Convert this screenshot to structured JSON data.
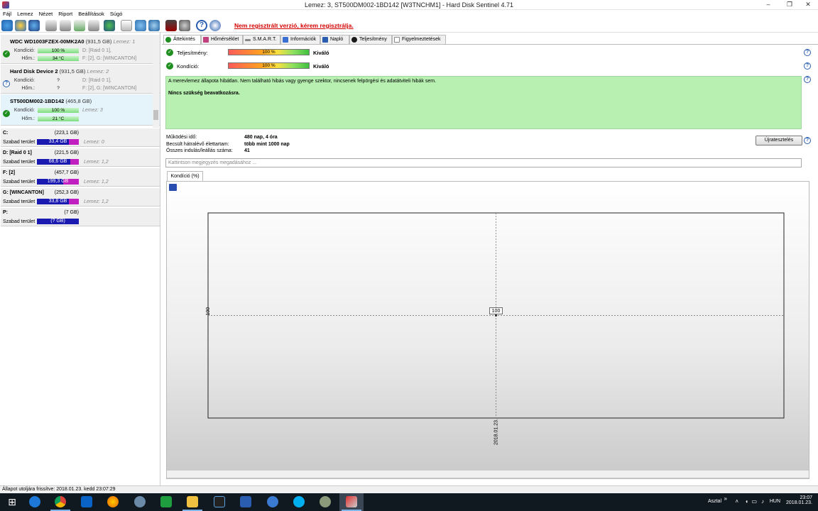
{
  "window": {
    "title": "Lemez: 3, ST500DM002-1BD142 [W3TNCHM1]  -  Hard Disk Sentinel 4.71",
    "minimize": "–",
    "maximize": "❐",
    "close": "✕"
  },
  "menu": [
    "Fájl",
    "Lemez",
    "Nézet",
    "Riport",
    "Beállítások",
    "Súgó"
  ],
  "toolbar": {
    "registration_warning": "Nem regisztrált verzió, kérem regisztrálja."
  },
  "disks": [
    {
      "name": "WDC WD1003FZEX-00MK2A0",
      "size": "(931,5 GB)",
      "disk_num": "Lemez: 1",
      "status": "ok",
      "health_label": "Kondíció:",
      "health": "100 %",
      "health_fraction": 1.0,
      "temp_label": "Hőm.:",
      "temp": "34 °C",
      "temp_bar": true,
      "part1": "D: [Raid 0 1],",
      "part2": "F: [2], G: [WINCANTON]"
    },
    {
      "name": "Hard Disk Device 2",
      "size": "(931,5 GB)",
      "disk_num": "Lemez: 2",
      "status": "unknown",
      "health_label": "Kondíció:",
      "health": "?",
      "temp_label": "Hőm.:",
      "temp": "?",
      "temp_bar": false,
      "part1": "D: [Raid 0 1],",
      "part2": "F: [2], G: [WINCANTON]"
    },
    {
      "name": "ST500DM002-1BD142",
      "size": "(465,8 GB)",
      "disk_num": "Lemez: 3",
      "status": "ok",
      "health_label": "Kondíció:",
      "health": "100 %",
      "health_fraction": 1.0,
      "temp_label": "Hőm.:",
      "temp": "21 °C",
      "temp_bar": true,
      "part1": "",
      "part2": ""
    }
  ],
  "volumes": [
    {
      "name": "C:",
      "size": "(223,1 GB)",
      "free_label": "Szabad terület",
      "free": "33,4 GB",
      "disk": "Lemez: 0"
    },
    {
      "name": "D: [Raid 0 1]",
      "size": "(221,5 GB)",
      "free_label": "Szabad terület",
      "free": "68,6 GB",
      "disk": "Lemez: 1,2"
    },
    {
      "name": "F: [2]",
      "size": "(457,7 GB)",
      "free_label": "Szabad terület",
      "free": "199,3 GB",
      "disk": "Lemez: 1,2"
    },
    {
      "name": "G: [WINCANTON]",
      "size": "(252,3 GB)",
      "free_label": "Szabad terület",
      "free": "33,8 GB",
      "disk": "Lemez: 1,2"
    },
    {
      "name": "P:",
      "size": "(7 GB)",
      "free_label": "Szabad terület",
      "free": "(? GB)",
      "disk": ""
    }
  ],
  "tabs": [
    "Áttekintés",
    "Hőmérséklet",
    "S.M.A.R.T.",
    "Információk",
    "Napló",
    "Teljesítmény",
    "Figyelmeztetések"
  ],
  "overview": {
    "performance_label": "Teljesítmény:",
    "performance_value": "100 %",
    "performance_fraction": 1.0,
    "performance_rating": "Kiváló",
    "health_label": "Kondíció:",
    "health_value": "100 %",
    "health_fraction": 1.0,
    "health_rating": "Kiváló",
    "status_text": "A merevlemez állapota hibátlan. Nem található hibás vagy gyenge szektor, nincsenek felpörgési és adatátviteli hibák sem.",
    "status_action": "Nincs szükség beavatkozásra.",
    "uptime_label": "Működési idő:",
    "uptime_value": "480 nap, 4 óra",
    "remaining_label": "Becsült hátralévő élettartam:",
    "remaining_value": "több mint 1000 nap",
    "startstop_label": "Összes indulás/leállás száma:",
    "startstop_value": "41",
    "retest_button": "Újratesztelés",
    "notes_placeholder": "Kattintson megjegyzés megadásához ...",
    "chart_tab": "Kondíció  (%)"
  },
  "chart_data": {
    "type": "line",
    "title": "",
    "x": [
      "2018.01.23."
    ],
    "series": [
      {
        "values": [
          100
        ]
      }
    ],
    "ytick": "100",
    "xtick": "2018.01.23.",
    "data_label": "100",
    "grid": true
  },
  "statusbar": "Állapot utoljára frissítve: 2018.01.23. kedd 23:07:29",
  "taskbar": {
    "desktop_label": "Asztal",
    "chevron": "»",
    "lang": "HUN",
    "time": "23:07",
    "date": "2018.01.23."
  },
  "colors": {
    "status_green": "#b7f0b0",
    "warning_red": "#d40000",
    "free_bar_blue": "#1a1ab0",
    "free_bar_magenta": "#c020c0"
  }
}
